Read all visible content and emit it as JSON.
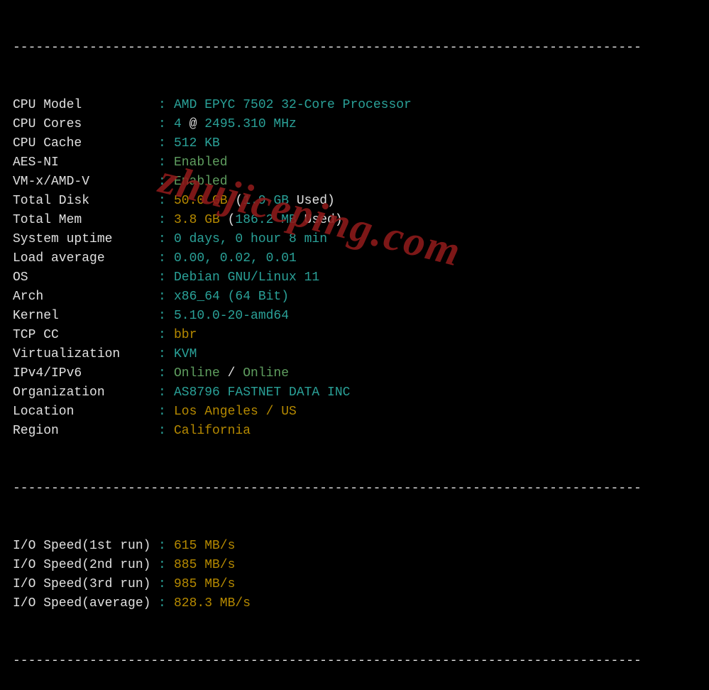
{
  "divider": "----------------------------------------------------------------------------------",
  "watermark": "zhujiceping.com",
  "rows": [
    {
      "label": "CPU Model",
      "parts": [
        {
          "t": "AMD EPYC 7502 32-Core Processor",
          "c": "cyan"
        }
      ]
    },
    {
      "label": "CPU Cores",
      "parts": [
        {
          "t": "4",
          "c": "cyan"
        },
        {
          "t": " @ ",
          "c": "white"
        },
        {
          "t": "2495.310 MHz",
          "c": "cyan"
        }
      ]
    },
    {
      "label": "CPU Cache",
      "parts": [
        {
          "t": "512 KB",
          "c": "cyan"
        }
      ]
    },
    {
      "label": "AES-NI",
      "parts": [
        {
          "t": "Enabled",
          "c": "green"
        }
      ]
    },
    {
      "label": "VM-x/AMD-V",
      "parts": [
        {
          "t": "Enabled",
          "c": "green"
        }
      ]
    },
    {
      "label": "Total Disk",
      "parts": [
        {
          "t": "50.0 GB",
          "c": "yellow"
        },
        {
          "t": " (",
          "c": "white"
        },
        {
          "t": "1.9 GB",
          "c": "cyan"
        },
        {
          "t": " Used)",
          "c": "white"
        }
      ]
    },
    {
      "label": "Total Mem",
      "parts": [
        {
          "t": "3.8 GB",
          "c": "yellow"
        },
        {
          "t": " (",
          "c": "white"
        },
        {
          "t": "186.2 MB",
          "c": "cyan"
        },
        {
          "t": " Used)",
          "c": "white"
        }
      ]
    },
    {
      "label": "System uptime",
      "parts": [
        {
          "t": "0 days, 0 hour 8 min",
          "c": "cyan"
        }
      ]
    },
    {
      "label": "Load average",
      "parts": [
        {
          "t": "0.00, 0.02, 0.01",
          "c": "cyan"
        }
      ]
    },
    {
      "label": "OS",
      "parts": [
        {
          "t": "Debian GNU/Linux 11",
          "c": "cyan"
        }
      ]
    },
    {
      "label": "Arch",
      "parts": [
        {
          "t": "x86_64 (64 Bit)",
          "c": "cyan"
        }
      ]
    },
    {
      "label": "Kernel",
      "parts": [
        {
          "t": "5.10.0-20-amd64",
          "c": "cyan"
        }
      ]
    },
    {
      "label": "TCP CC",
      "parts": [
        {
          "t": "bbr",
          "c": "yellow"
        }
      ]
    },
    {
      "label": "Virtualization",
      "parts": [
        {
          "t": "KVM",
          "c": "cyan"
        }
      ]
    },
    {
      "label": "IPv4/IPv6",
      "parts": [
        {
          "t": "Online",
          "c": "green"
        },
        {
          "t": " / ",
          "c": "white"
        },
        {
          "t": "Online",
          "c": "green"
        }
      ]
    },
    {
      "label": "Organization",
      "parts": [
        {
          "t": "AS8796 FASTNET DATA INC",
          "c": "cyan"
        }
      ]
    },
    {
      "label": "Location",
      "parts": [
        {
          "t": "Los Angeles / US",
          "c": "yellow"
        }
      ]
    },
    {
      "label": "Region",
      "parts": [
        {
          "t": "California",
          "c": "yellow"
        }
      ]
    }
  ],
  "io_rows": [
    {
      "label": "I/O Speed(1st run)",
      "parts": [
        {
          "t": "615 MB/s",
          "c": "yellow"
        }
      ]
    },
    {
      "label": "I/O Speed(2nd run)",
      "parts": [
        {
          "t": "885 MB/s",
          "c": "yellow"
        }
      ]
    },
    {
      "label": "I/O Speed(3rd run)",
      "parts": [
        {
          "t": "985 MB/s",
          "c": "yellow"
        }
      ]
    },
    {
      "label": "I/O Speed(average)",
      "parts": [
        {
          "t": "828.3 MB/s",
          "c": "yellow"
        }
      ]
    }
  ]
}
